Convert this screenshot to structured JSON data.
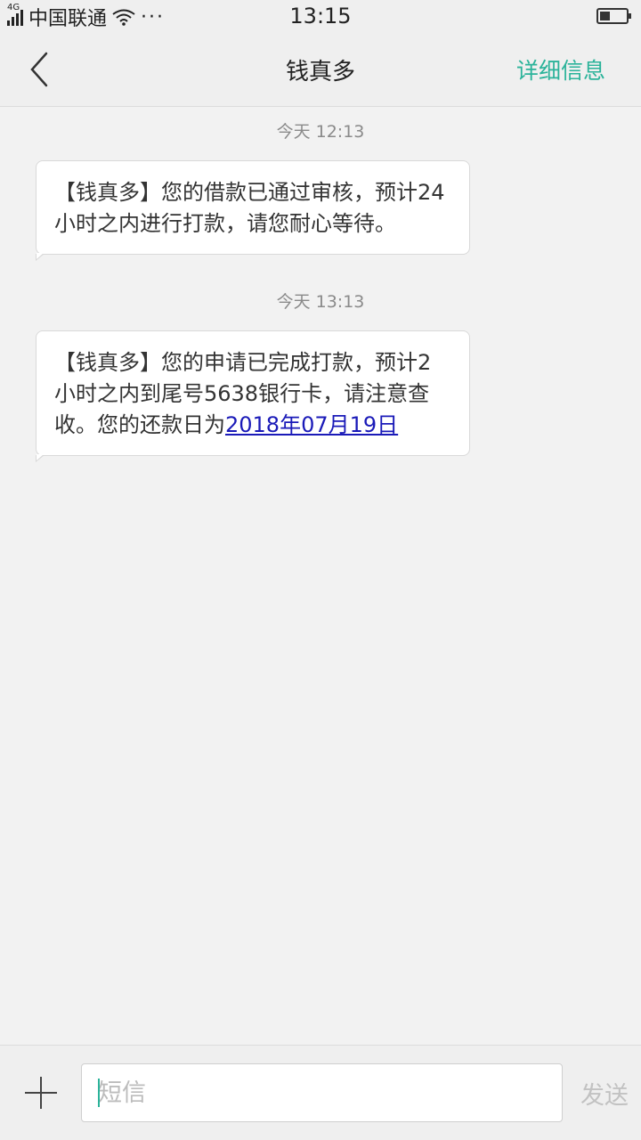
{
  "status_bar": {
    "network": "4G",
    "carrier": "中国联通",
    "dots": "···",
    "time": "13:15",
    "battery_level": 0.4
  },
  "header": {
    "title": "钱真多",
    "detail_label": "详细信息"
  },
  "messages": [
    {
      "timestamp": "今天  12:13",
      "text": "【钱真多】您的借款已通过审核，预计24小时之内进行打款，请您耐心等待。",
      "link": ""
    },
    {
      "timestamp": "今天  13:13",
      "text": "【钱真多】您的申请已完成打款，预计2小时之内到尾号5638银行卡，请注意查收。您的还款日为",
      "link": "2018年07月19日"
    }
  ],
  "composer": {
    "placeholder": "短信",
    "send_label": "发送"
  },
  "colors": {
    "accent": "#2bb39a",
    "link": "#1a1ab8",
    "background": "#f2f2f2"
  }
}
